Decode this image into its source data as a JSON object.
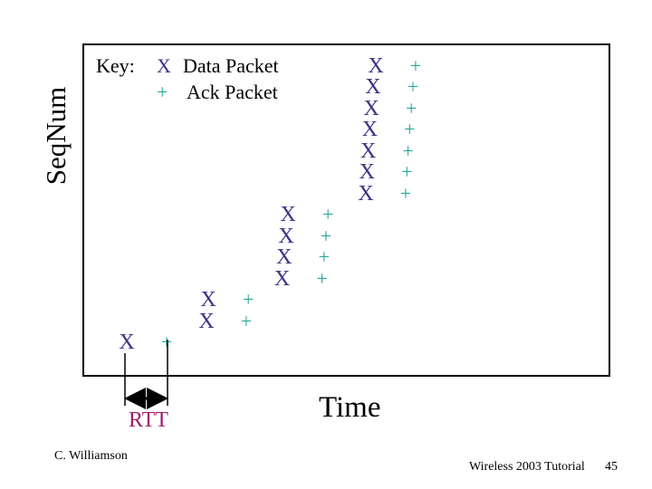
{
  "slide": {
    "footer_author": "C. Williamson",
    "footer_title": "Wireless 2003 Tutorial",
    "page_number": "45"
  },
  "chart_data": {
    "type": "scatter",
    "title": "",
    "xlabel": "Time",
    "ylabel": "SeqNum",
    "grid": false,
    "legend": {
      "placement": "top-left",
      "title": "Key:",
      "entries": [
        {
          "symbol": "X",
          "label": "Data Packet",
          "color": "#3b3585"
        },
        {
          "symbol": "+",
          "label": "Ack Packet",
          "color": "#2aa89a"
        }
      ]
    },
    "annotation": {
      "label": "RTT",
      "color": "#a0206a",
      "from_time": 1,
      "to_time": 2
    },
    "xlim": [
      0,
      12
    ],
    "ylim": [
      0,
      16
    ],
    "series": [
      {
        "name": "Data Packet",
        "symbol": "X",
        "color": "#3b3585",
        "points": [
          {
            "t": 1.0,
            "seq": 1
          },
          {
            "t": 3.0,
            "seq": 2
          },
          {
            "t": 3.05,
            "seq": 3
          },
          {
            "t": 4.9,
            "seq": 4
          },
          {
            "t": 4.95,
            "seq": 5
          },
          {
            "t": 5.0,
            "seq": 6
          },
          {
            "t": 5.05,
            "seq": 7
          },
          {
            "t": 7.0,
            "seq": 8
          },
          {
            "t": 7.03,
            "seq": 9
          },
          {
            "t": 7.06,
            "seq": 10
          },
          {
            "t": 7.1,
            "seq": 11
          },
          {
            "t": 7.14,
            "seq": 12
          },
          {
            "t": 7.18,
            "seq": 13
          },
          {
            "t": 7.25,
            "seq": 14
          }
        ]
      },
      {
        "name": "Ack Packet",
        "symbol": "+",
        "color": "#2aa89a",
        "points": [
          {
            "t": 2.0,
            "seq": 1
          },
          {
            "t": 4.0,
            "seq": 2
          },
          {
            "t": 4.05,
            "seq": 3
          },
          {
            "t": 5.9,
            "seq": 4
          },
          {
            "t": 5.95,
            "seq": 5
          },
          {
            "t": 6.0,
            "seq": 6
          },
          {
            "t": 6.05,
            "seq": 7
          },
          {
            "t": 8.0,
            "seq": 8
          },
          {
            "t": 8.03,
            "seq": 9
          },
          {
            "t": 8.06,
            "seq": 10
          },
          {
            "t": 8.1,
            "seq": 11
          },
          {
            "t": 8.14,
            "seq": 12
          },
          {
            "t": 8.18,
            "seq": 13
          },
          {
            "t": 8.25,
            "seq": 14
          }
        ]
      }
    ]
  }
}
